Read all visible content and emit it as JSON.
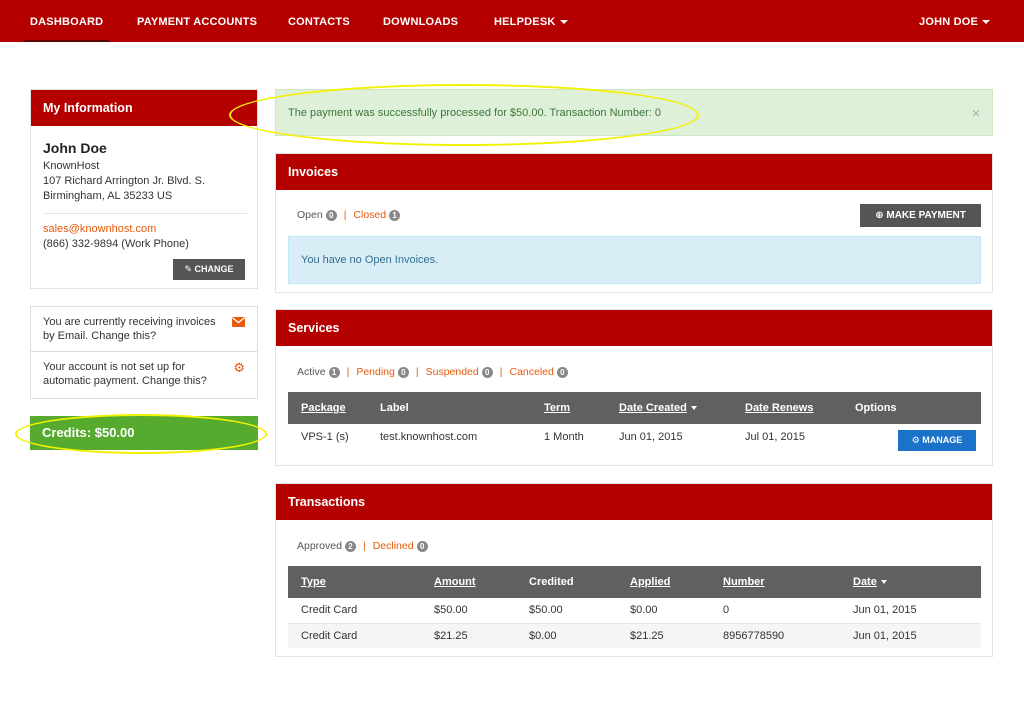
{
  "nav": {
    "dashboard": "DASHBOARD",
    "payment_accounts": "PAYMENT ACCOUNTS",
    "contacts": "CONTACTS",
    "downloads": "DOWNLOADS",
    "helpdesk": "HELPDESK",
    "user": "JOHN DOE"
  },
  "my_info": {
    "title": "My Information",
    "name": "John Doe",
    "company": "KnownHost",
    "address1": "107 Richard Arrington Jr. Blvd. S.",
    "address2": "Birmingham, AL 35233 US",
    "email": "sales@knownhost.com",
    "phone": "(866) 332-9894 (Work Phone)",
    "change_label": "CHANGE"
  },
  "notices": {
    "invoices": "You are currently receiving invoices by Email. Change this?",
    "autopay": "Your account is not set up for automatic payment. Change this?"
  },
  "credits": "Credits: $50.00",
  "alert": {
    "message": "The payment was successfully processed for $50.00. Transaction Number: 0",
    "close": "×"
  },
  "invoices": {
    "title": "Invoices",
    "filters": [
      {
        "label": "Open",
        "count": "0"
      },
      {
        "label": "Closed",
        "count": "1"
      }
    ],
    "make_payment": "MAKE PAYMENT",
    "empty": "You have no Open Invoices."
  },
  "services": {
    "title": "Services",
    "filters": [
      {
        "label": "Active",
        "count": "1"
      },
      {
        "label": "Pending",
        "count": "0"
      },
      {
        "label": "Suspended",
        "count": "0"
      },
      {
        "label": "Canceled",
        "count": "0"
      }
    ],
    "columns": [
      "Package",
      "Label",
      "Term",
      "Date Created",
      "Date Renews",
      "Options"
    ],
    "rows": [
      {
        "package": "VPS-1 (s)",
        "label": "test.knownhost.com",
        "term": "1 Month",
        "created": "Jun 01, 2015",
        "renews": "Jul 01, 2015"
      }
    ],
    "manage": "MANAGE"
  },
  "transactions": {
    "title": "Transactions",
    "filters": [
      {
        "label": "Approved",
        "count": "2"
      },
      {
        "label": "Declined",
        "count": "0"
      }
    ],
    "columns": [
      "Type",
      "Amount",
      "Credited",
      "Applied",
      "Number",
      "Date"
    ],
    "rows": [
      {
        "type": "Credit Card",
        "amount": "$50.00",
        "credited": "$50.00",
        "applied": "$0.00",
        "number": "0",
        "date": "Jun 01, 2015"
      },
      {
        "type": "Credit Card",
        "amount": "$21.25",
        "credited": "$0.00",
        "applied": "$21.25",
        "number": "8956778590",
        "date": "Jun 01, 2015"
      }
    ]
  },
  "colors": {
    "brand_red": "#b50000",
    "accent_orange": "#e8590c",
    "credits_green": "#56ab2f",
    "highlight_yellow": "#f2f200"
  }
}
